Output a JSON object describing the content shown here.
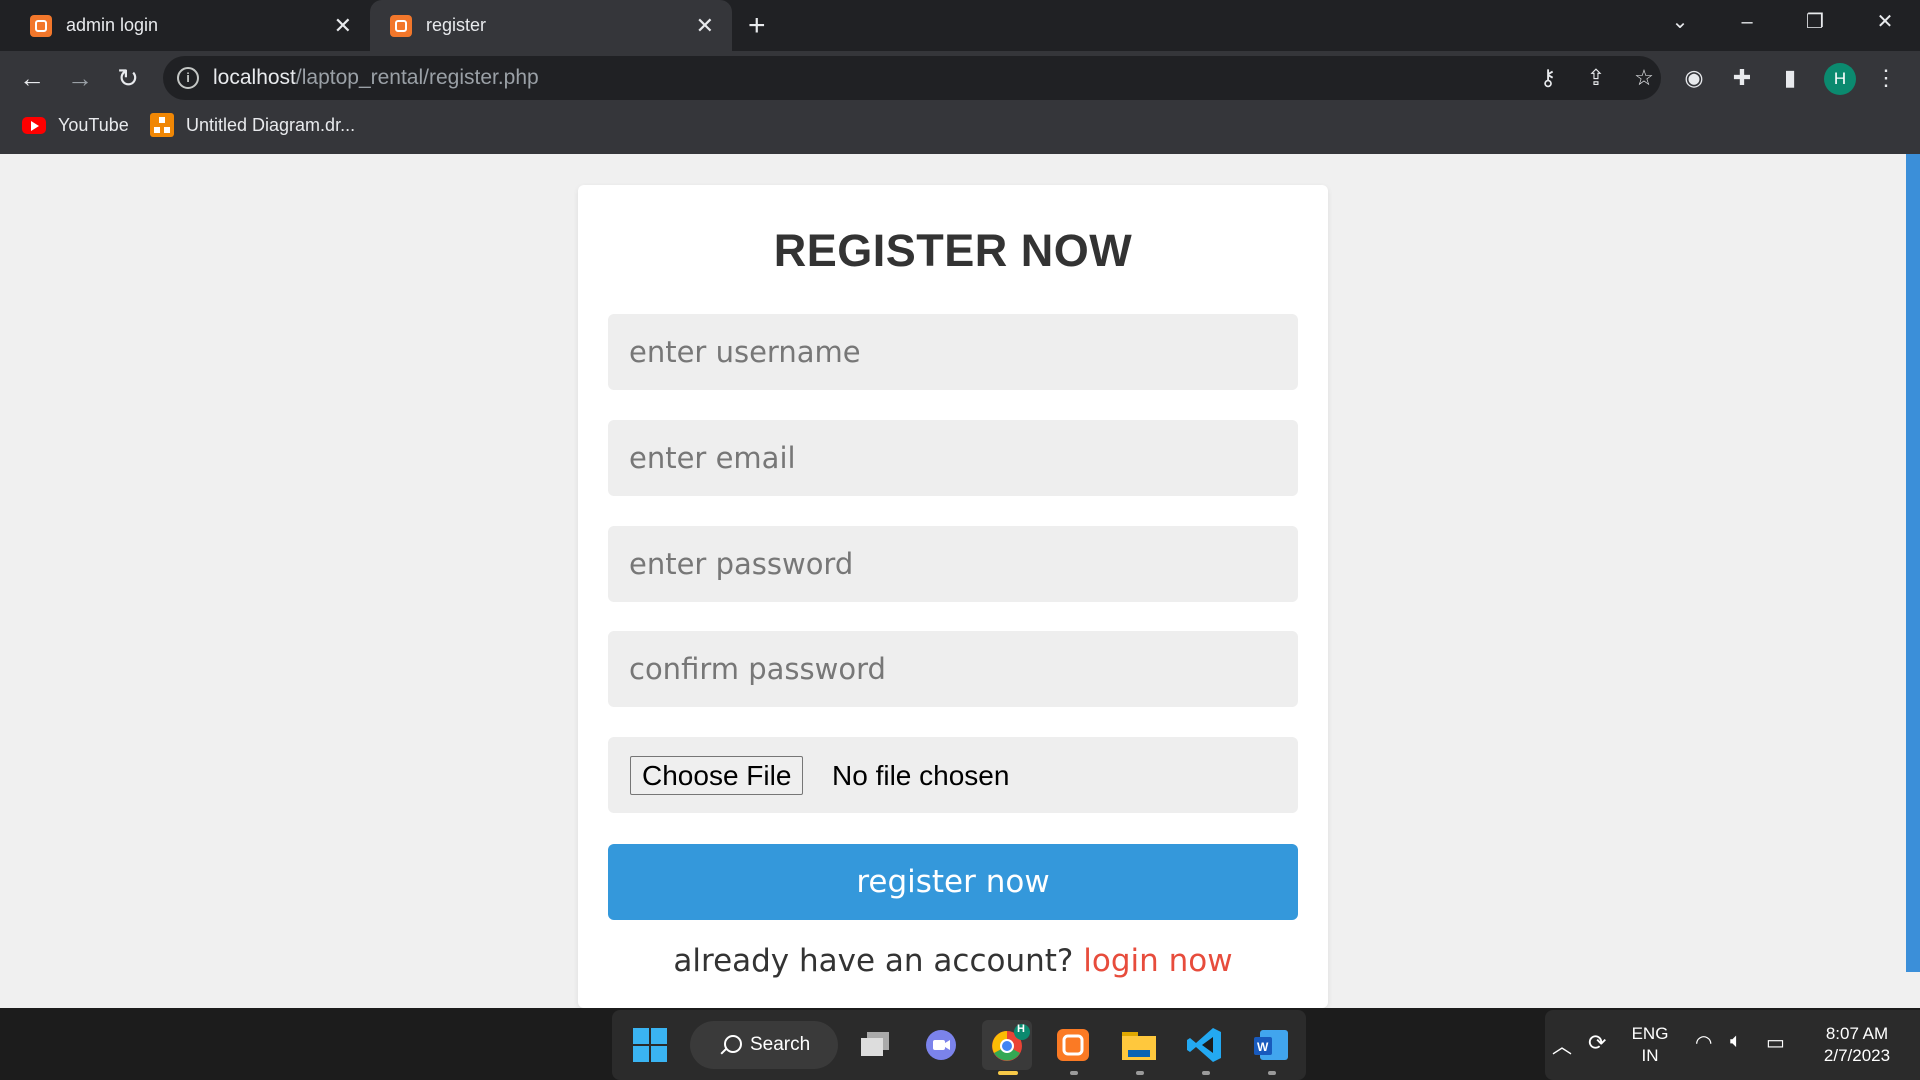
{
  "browser": {
    "tabs": [
      {
        "title": "admin login",
        "active": false
      },
      {
        "title": "register",
        "active": true
      }
    ],
    "new_tab": "+",
    "window_controls": {
      "tabsearch": "⌄",
      "minimize": "–",
      "restore": "❐",
      "close": "✕"
    },
    "nav": {
      "back": "←",
      "forward": "→",
      "reload": "↻"
    },
    "url_host": "localhost",
    "url_path": "/laptop_rental/register.php",
    "profile_initial": "H",
    "bookmarks": [
      {
        "label": "YouTube"
      },
      {
        "label": "Untitled Diagram.dr..."
      }
    ]
  },
  "form": {
    "title": "REGISTER NOW",
    "username_placeholder": "enter username",
    "email_placeholder": "enter email",
    "password_placeholder": "enter password",
    "confirm_placeholder": "confirm password",
    "file_button": "Choose File",
    "file_status": "No file chosen",
    "submit_label": "register now",
    "footer_text": "already have an account?",
    "footer_link": "login now"
  },
  "taskbar": {
    "search_label": "Search",
    "language_line1": "ENG",
    "language_line2": "IN",
    "time": "8:07 AM",
    "date": "2/7/2023",
    "chrome_badge": "H"
  },
  "colors": {
    "accent": "#3498db",
    "link": "#e74c3c",
    "chrome_bg": "#35363a",
    "tabstrip_bg": "#202124"
  }
}
